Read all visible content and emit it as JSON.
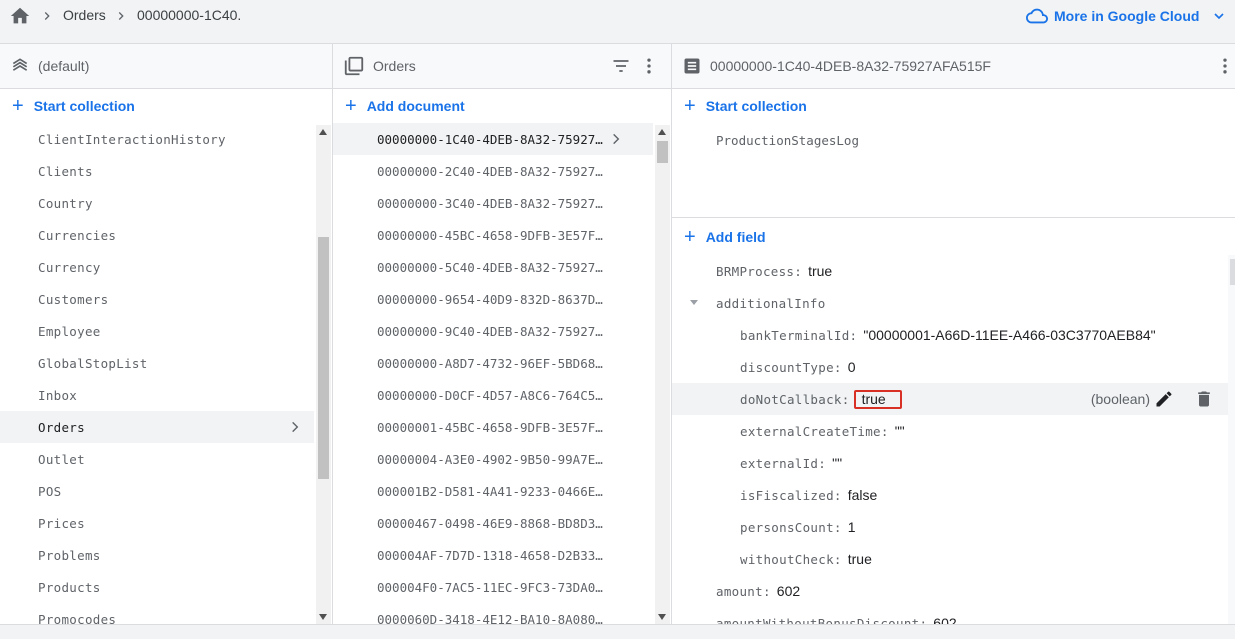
{
  "breadcrumb": {
    "items": [
      "Orders",
      "00000000-1C40."
    ]
  },
  "header_action": {
    "label": "More in Google Cloud"
  },
  "root_panel": {
    "title": "(default)",
    "add_label": "Start collection",
    "collections": [
      "ClientInteractionHistory",
      "Clients",
      "Country",
      "Currencies",
      "Currency",
      "Customers",
      "Employee",
      "GlobalStopList",
      "Inbox",
      "Orders",
      "Outlet",
      "POS",
      "Prices",
      "Problems",
      "Products",
      "Promocodes"
    ],
    "selected": "Orders"
  },
  "collection_panel": {
    "title": "Orders",
    "add_label": "Add document",
    "documents": [
      "00000000-1C40-4DEB-8A32-75927…",
      "00000000-2C40-4DEB-8A32-75927…",
      "00000000-3C40-4DEB-8A32-75927…",
      "00000000-45BC-4658-9DFB-3E57F…",
      "00000000-5C40-4DEB-8A32-75927…",
      "00000000-9654-40D9-832D-8637D…",
      "00000000-9C40-4DEB-8A32-75927…",
      "00000000-A8D7-4732-96EF-5BD68…",
      "00000000-D0CF-4D57-A8C6-764C5…",
      "00000001-45BC-4658-9DFB-3E57F…",
      "00000004-A3E0-4902-9B50-99A7E…",
      "000001B2-D581-4A41-9233-0466E…",
      "00000467-0498-46E9-8868-BD8D3…",
      "000004AF-7D7D-1318-4658-D2B33…",
      "000004F0-7AC5-11EC-9FC3-73DA0…",
      "0000060D-3418-4E12-BA10-8A080…"
    ],
    "selected_index": 0
  },
  "document_panel": {
    "title": "00000000-1C40-4DEB-8A32-75927AFA515F",
    "start_collection_label": "Start collection",
    "subcollections": [
      "ProductionStagesLog"
    ],
    "add_field_label": "Add field",
    "fields": [
      {
        "key": "BRMProcess:",
        "value": "true",
        "indent": 0
      },
      {
        "key": "additionalInfo",
        "value": "",
        "indent": 0,
        "expanded": true
      },
      {
        "key": "bankTerminalId:",
        "value": "\"00000001-A66D-11EE-A466-03C3770AEB84\"",
        "indent": 1
      },
      {
        "key": "discountType:",
        "value": "0",
        "indent": 1
      },
      {
        "key": "doNotCallback:",
        "value": "true",
        "indent": 1,
        "highlighted": true,
        "type": "(boolean)"
      },
      {
        "key": "externalCreateTime:",
        "value": "\"\"",
        "indent": 1
      },
      {
        "key": "externalId:",
        "value": "\"\"",
        "indent": 1
      },
      {
        "key": "isFiscalized:",
        "value": "false",
        "indent": 1
      },
      {
        "key": "personsCount:",
        "value": "1",
        "indent": 1
      },
      {
        "key": "withoutCheck:",
        "value": "true",
        "indent": 1
      },
      {
        "key": "amount:",
        "value": "602",
        "indent": 0
      },
      {
        "key": "amountWithoutBonusDiscount:",
        "value": "602",
        "indent": 0
      }
    ]
  },
  "colors": {
    "accent": "#1a73e8",
    "highlight_border": "#d93025",
    "panel_header": "#f8f9fa",
    "selected_row": "#f1f3f4"
  }
}
